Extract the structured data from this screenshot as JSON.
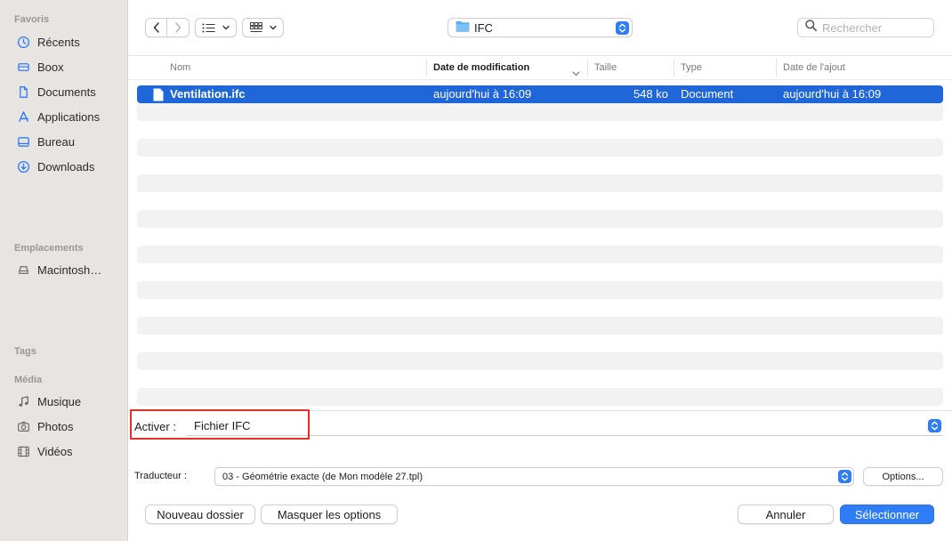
{
  "sidebar": {
    "favorites_title": "Favoris",
    "favorites": [
      {
        "label": "Récents",
        "icon": "clock-icon"
      },
      {
        "label": "Boox",
        "icon": "box-icon"
      },
      {
        "label": "Documents",
        "icon": "document-icon"
      },
      {
        "label": "Applications",
        "icon": "applications-icon"
      },
      {
        "label": "Bureau",
        "icon": "desktop-icon"
      },
      {
        "label": "Downloads",
        "icon": "download-icon"
      }
    ],
    "locations_title": "Emplacements",
    "locations": [
      {
        "label": "Macintosh…",
        "icon": "disk-icon"
      }
    ],
    "tags_title": "Tags",
    "media_title": "Média",
    "media": [
      {
        "label": "Musique",
        "icon": "music-icon"
      },
      {
        "label": "Photos",
        "icon": "camera-icon"
      },
      {
        "label": "Vidéos",
        "icon": "film-icon"
      }
    ]
  },
  "toolbar": {
    "path": "IFC",
    "search_placeholder": "Rechercher"
  },
  "table": {
    "columns": {
      "name": "Nom",
      "date": "Date de modification",
      "size": "Taille",
      "type": "Type",
      "added": "Date de l'ajout"
    },
    "rows": [
      {
        "name": "Ventilation.ifc",
        "date": "aujourd'hui à 16:09",
        "size": "548 ko",
        "type": "Document",
        "added": "aujourd'hui à 16:09"
      }
    ]
  },
  "options": {
    "activate_label": "Activer :",
    "format_value": "Fichier IFC",
    "translator_label": "Traducteur :",
    "translator_value": "03 - Géométrie exacte (de Mon modèle 27.tpl)",
    "options_button": "Options..."
  },
  "footer": {
    "new_folder": "Nouveau dossier",
    "hide_options": "Masquer les options",
    "cancel": "Annuler",
    "select": "Sélectionner"
  },
  "colors": {
    "accent": "#2f7df6",
    "selection": "#1f66d9",
    "highlight_box": "#e0302a",
    "sidebar_bg": "#e8e4e2"
  }
}
